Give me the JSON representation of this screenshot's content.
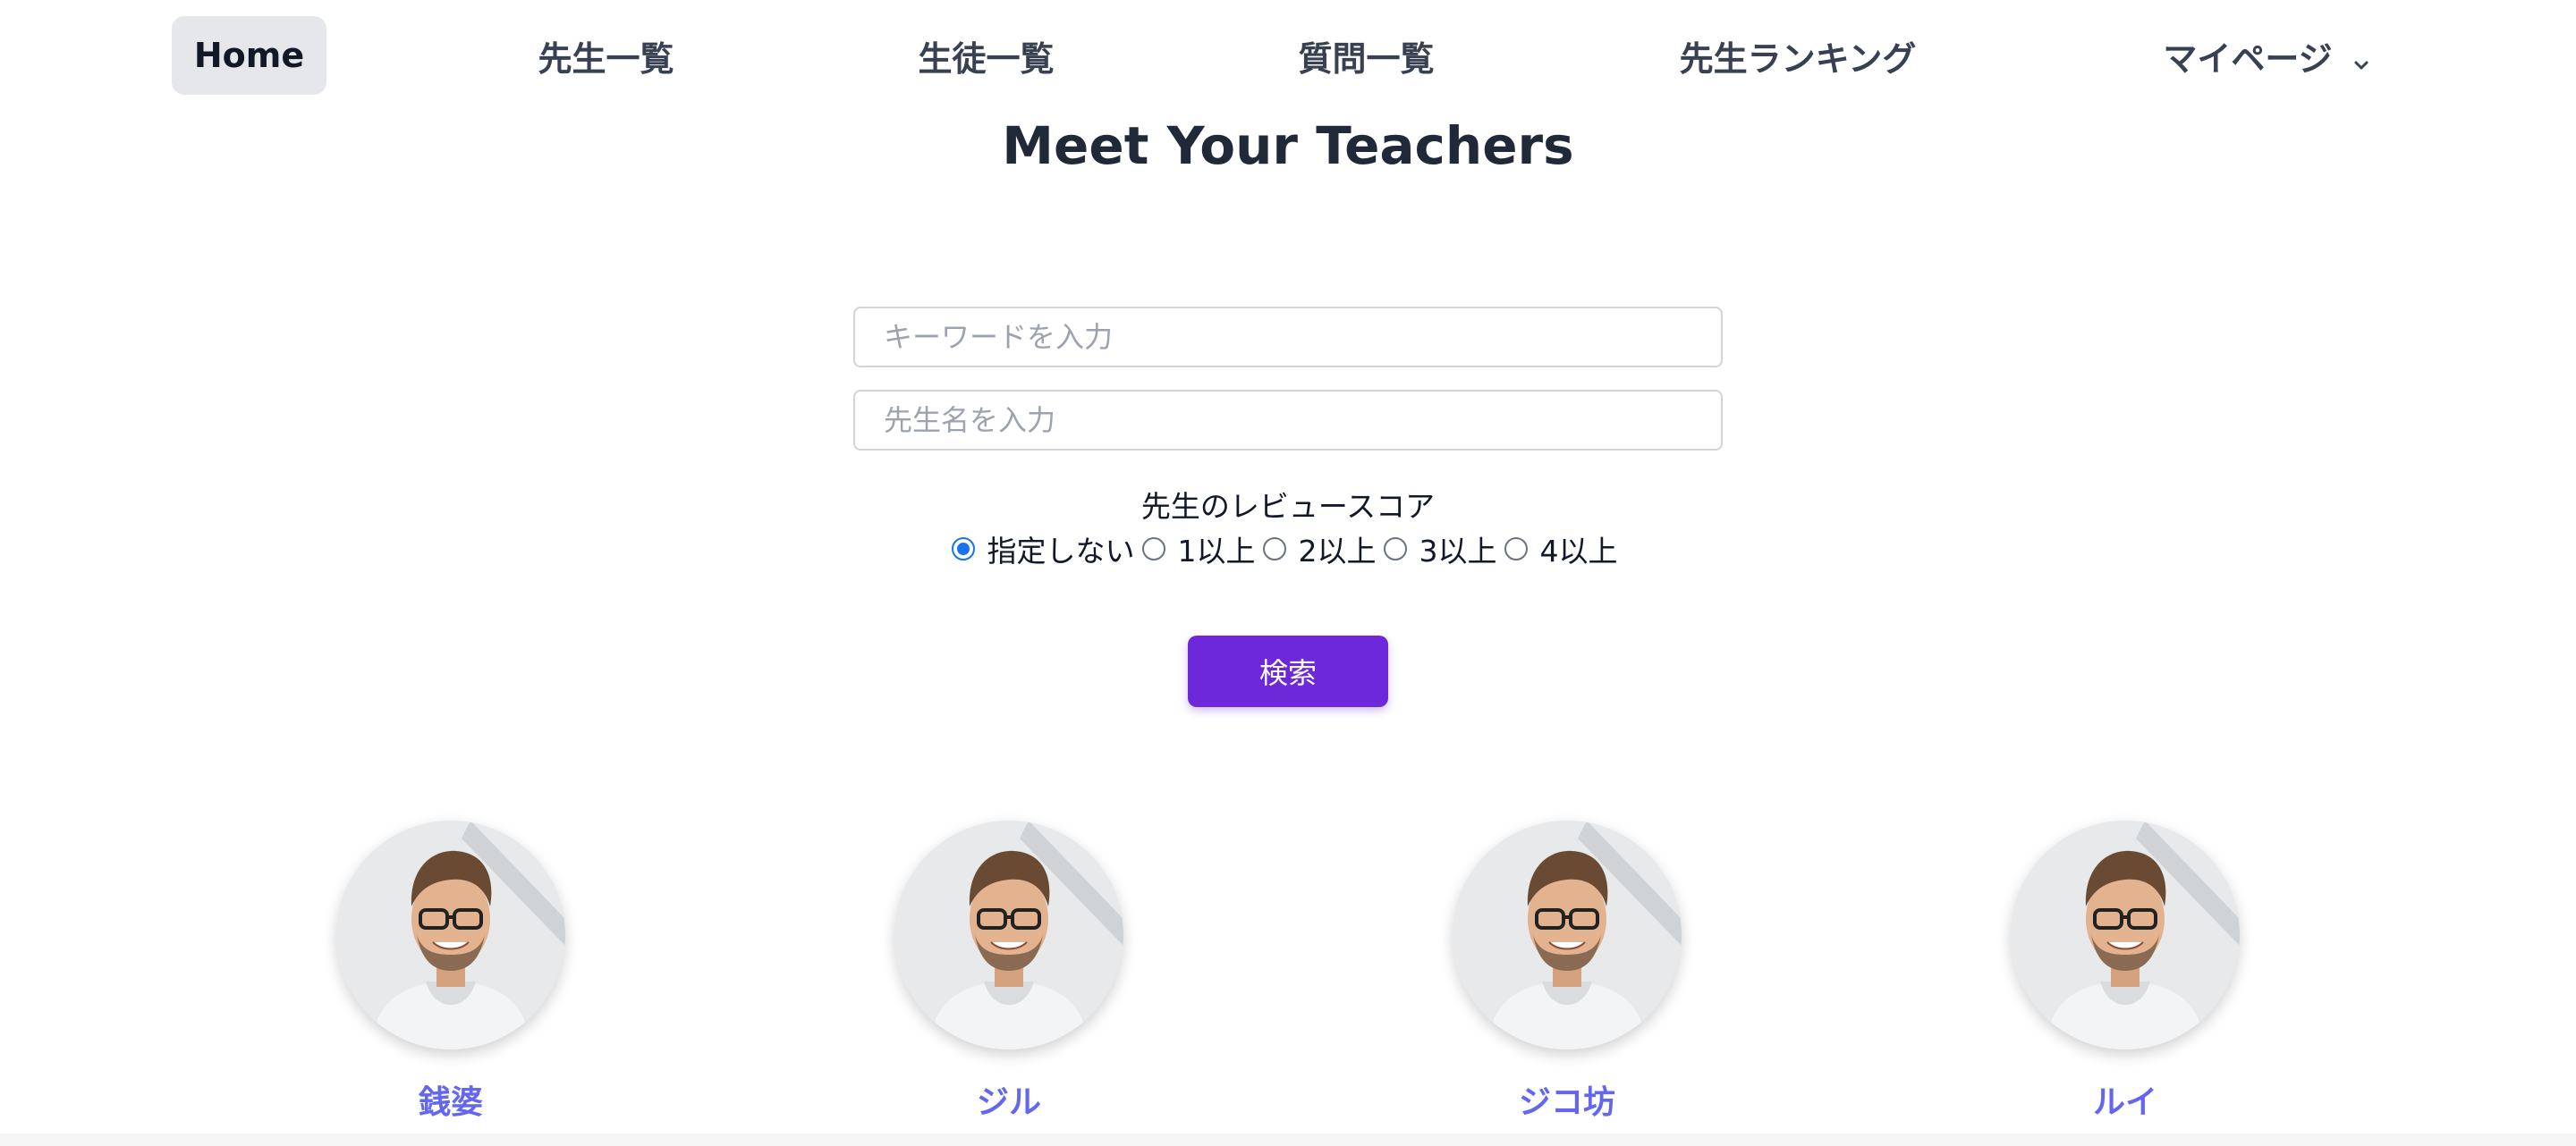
{
  "nav": {
    "home": "Home",
    "teachers": "先生一覧",
    "students": "生徒一覧",
    "questions": "質問一覧",
    "ranking": "先生ランキング",
    "mypage": "マイページ",
    "mypage_icon": "chevron-down-icon"
  },
  "page_title": "Meet Your Teachers",
  "search": {
    "keyword_placeholder": "キーワードを入力",
    "keyword_value": "",
    "teacher_placeholder": "先生名を入力",
    "teacher_value": "",
    "review_label": "先生のレビュースコア",
    "review_options": [
      "指定しない",
      "1以上",
      "2以上",
      "3以上",
      "4以上"
    ],
    "selected_option": "指定しない",
    "button_label": "検索"
  },
  "teachers": [
    {
      "name": "銭婆"
    },
    {
      "name": "ジル"
    },
    {
      "name": "ジコ坊"
    },
    {
      "name": "ルイ"
    }
  ],
  "colors": {
    "accent": "#6d28d9",
    "teacher_name": "#6366f1",
    "radio_checked": "#1a73e8",
    "home_active_bg": "#e5e7eb"
  }
}
